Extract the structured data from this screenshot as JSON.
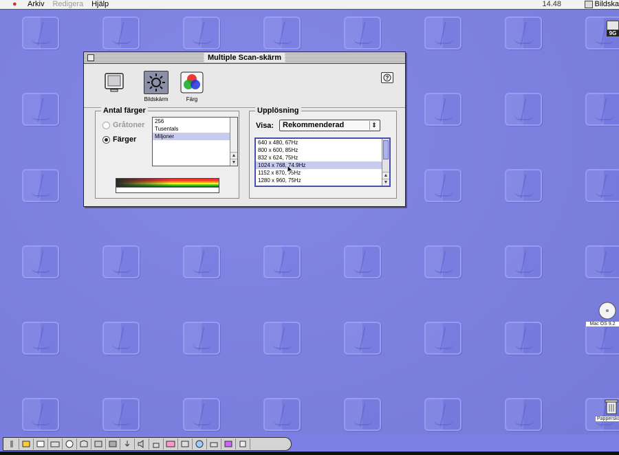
{
  "menubar": {
    "menus": [
      {
        "label": "Arkiv",
        "disabled": false
      },
      {
        "label": "Redigera",
        "disabled": true
      },
      {
        "label": "Hjälp",
        "disabled": false
      }
    ],
    "clock": "14.48",
    "app_name": "Bildska"
  },
  "window": {
    "title": "Multiple Scan-skärm",
    "toolbar": {
      "buttons": [
        {
          "label": "",
          "icon": "monitor-icon",
          "selected": false
        },
        {
          "label": "Bildskärm",
          "icon": "brightness-icon",
          "selected": true
        },
        {
          "label": "Färg",
          "icon": "color-wheel-icon",
          "selected": false
        }
      ],
      "help_icon": "help-icon"
    },
    "colors": {
      "title": "Antal färger",
      "radios": [
        {
          "label": "Gråtoner",
          "checked": false,
          "disabled": true
        },
        {
          "label": "Färger",
          "checked": true,
          "disabled": false
        }
      ],
      "depth_options": [
        "256",
        "Tusentals",
        "Miljoner"
      ],
      "selected_depth": "Miljoner"
    },
    "resolution": {
      "title": "Upplösning",
      "visa_label": "Visa:",
      "visa_value": "Rekommenderad",
      "options": [
        "640 x 480, 67Hz",
        "800 x 600, 85Hz",
        "832 x 624, 75Hz",
        "1024 x 768, 74.9Hz",
        "1152 x 870, 75Hz",
        "1280 x 960, 75Hz"
      ],
      "selected": "1024 x 768, 74.9Hz"
    }
  },
  "desktop": {
    "drive_label": "9G",
    "cd_label": "Mac OS 9.2",
    "trash_label": "Papperskorg"
  },
  "colors": {
    "desktop": "#7c80e4",
    "selection": "#c8cbf0"
  }
}
